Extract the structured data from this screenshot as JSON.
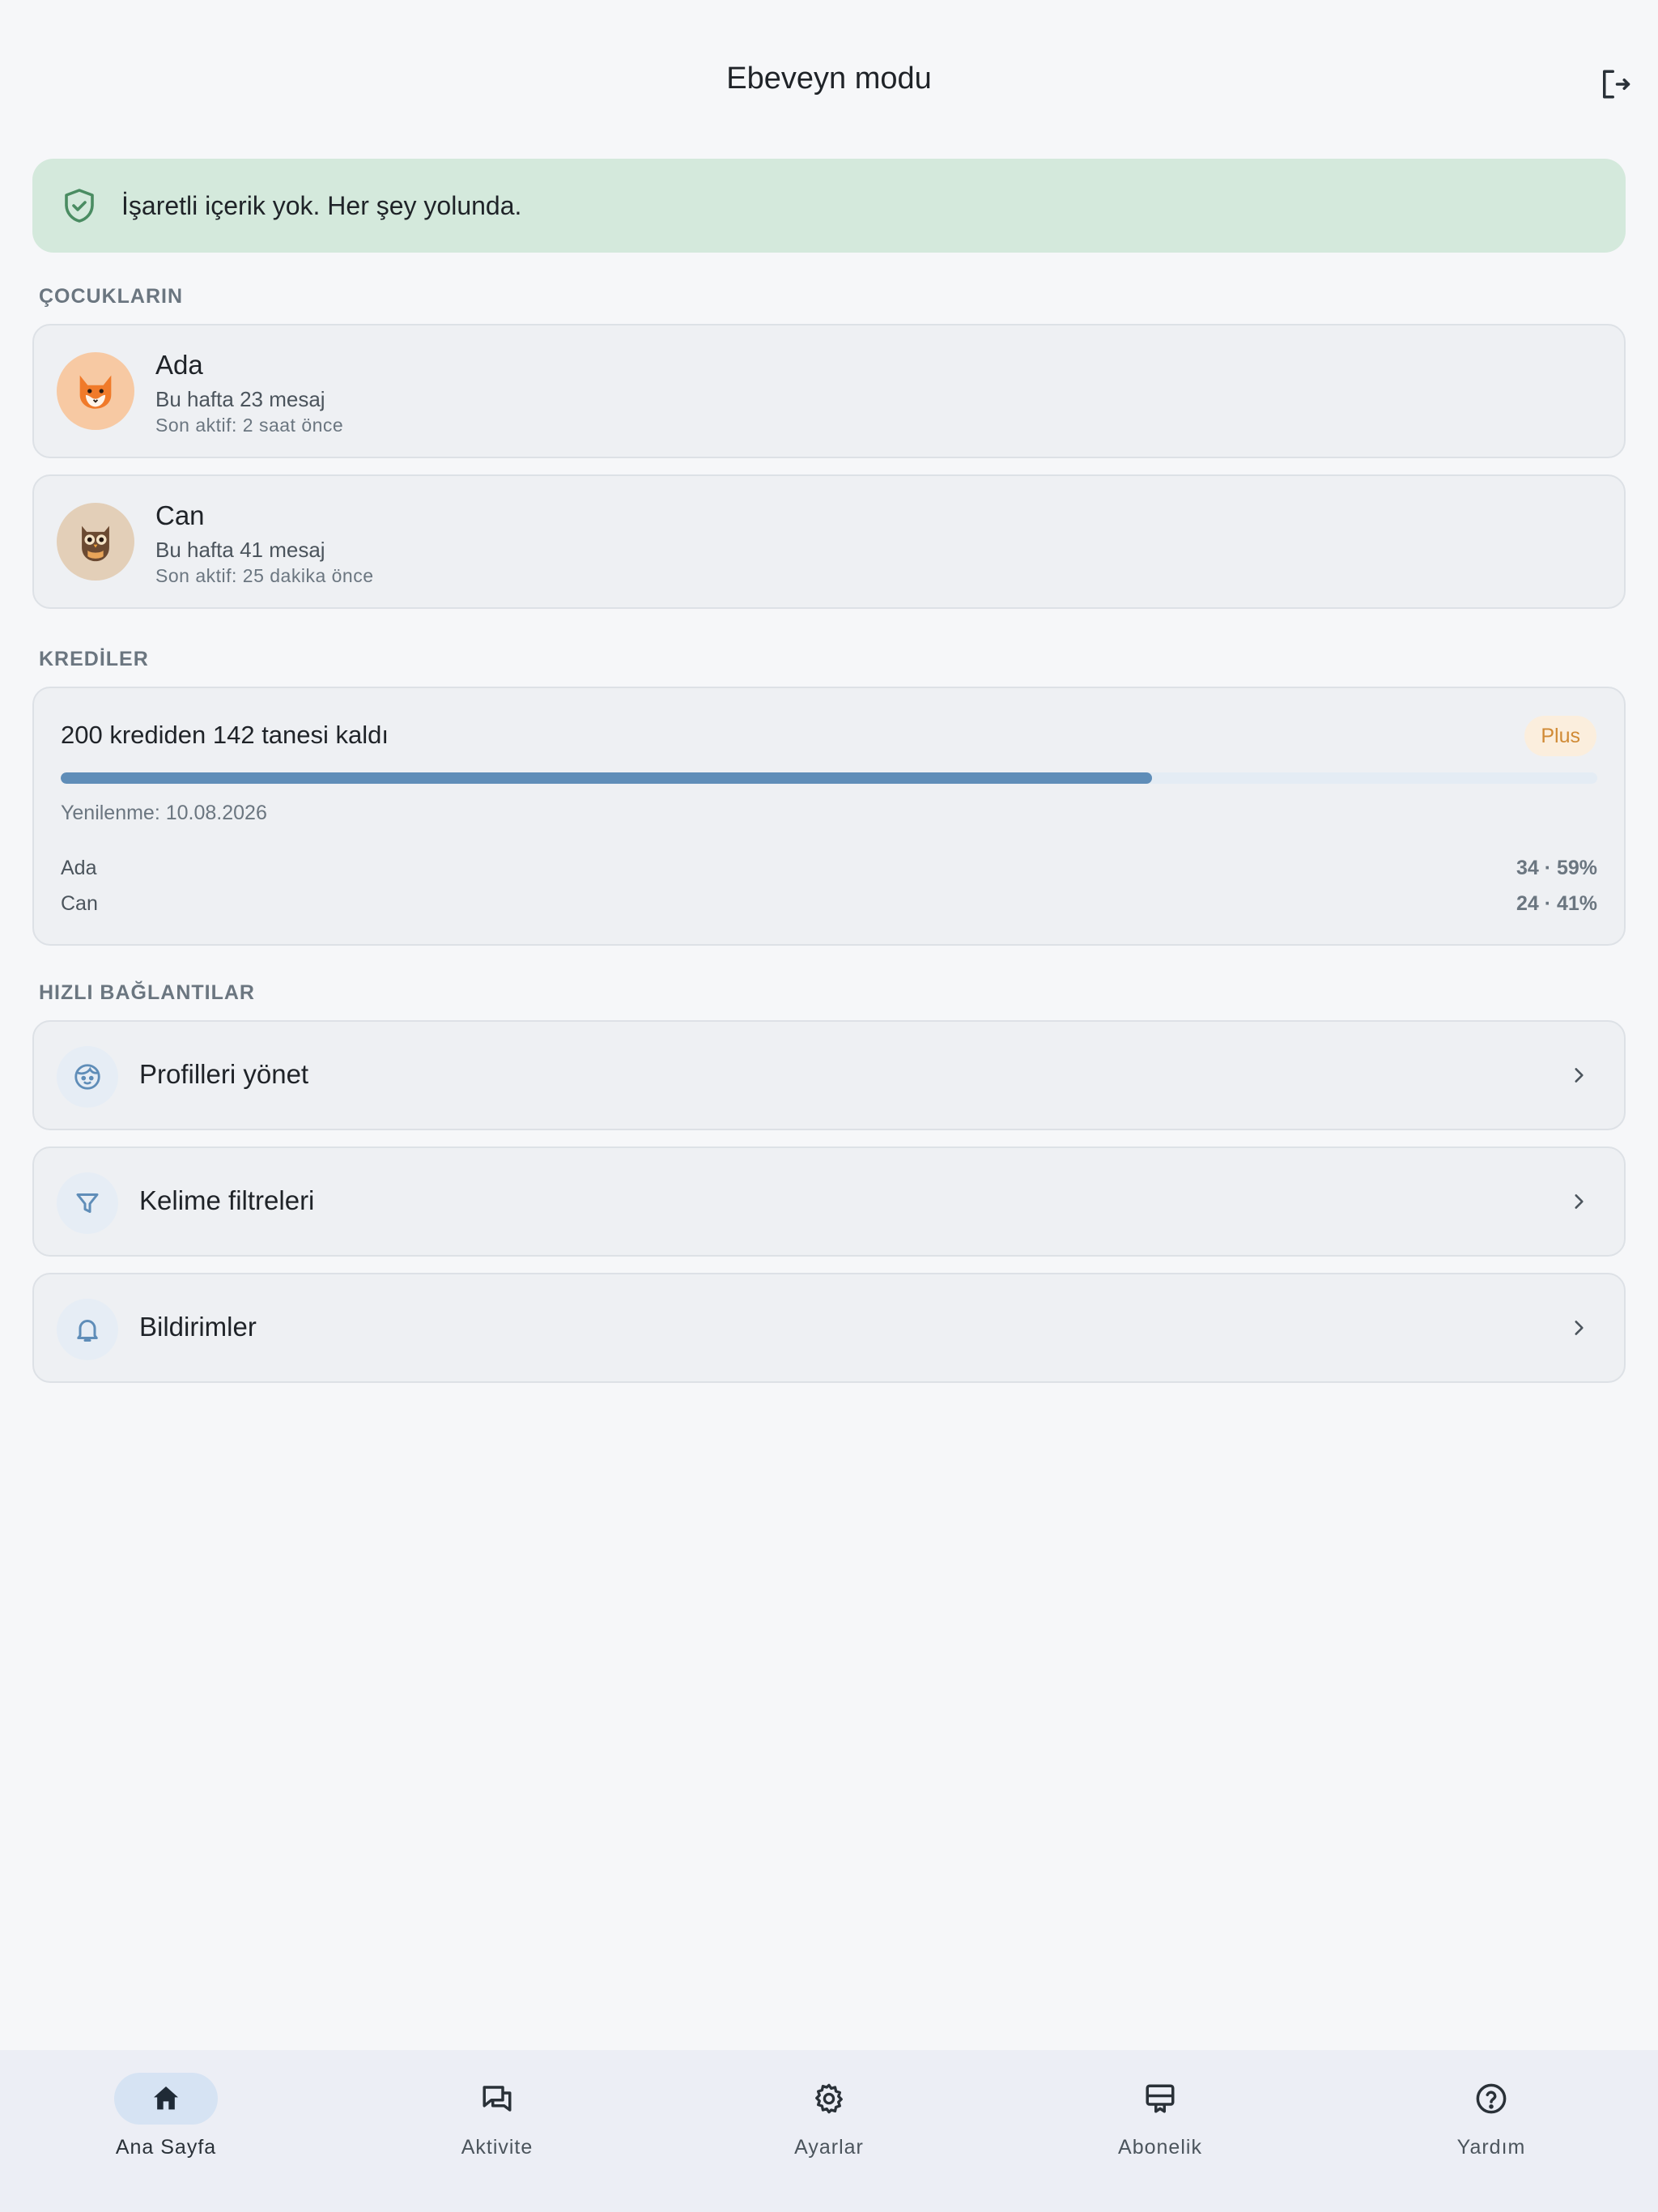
{
  "header": {
    "title": "Ebeveyn modu",
    "logout_icon": "logout-icon"
  },
  "banner": {
    "text": "İşaretli içerik yok. Her şey yolunda.",
    "icon": "shield-check-icon",
    "color": "#d4e9dc"
  },
  "children_section": {
    "label": "ÇOCUKLARIN",
    "items": [
      {
        "name": "Ada",
        "week": "Bu hafta 23 mesaj",
        "active": "Son aktif: 2 saat önce",
        "avatar": "fox-avatar",
        "avatar_bg": "#f7c9a3"
      },
      {
        "name": "Can",
        "week": "Bu hafta 41 mesaj",
        "active": "Son aktif: 25 dakika önce",
        "avatar": "owl-avatar",
        "avatar_bg": "#e3cfb8"
      }
    ]
  },
  "credits_section": {
    "label": "KREDİLER",
    "title": "200 krediden 142 tanesi kaldı",
    "plan": "Plus",
    "remaining": 142,
    "total": 200,
    "progress_fraction": 0.71,
    "renewal": "Yenilenme: 10.08.2026",
    "usage": [
      {
        "name": "Ada",
        "value": "34 · 59%"
      },
      {
        "name": "Can",
        "value": "24 · 41%"
      }
    ],
    "accent": "#5f8db8"
  },
  "links_section": {
    "label": "HIZLI BAĞLANTILAR",
    "items": [
      {
        "label": "Profilleri yönet",
        "icon": "child-face-icon"
      },
      {
        "label": "Kelime filtreleri",
        "icon": "filter-icon"
      },
      {
        "label": "Bildirimler",
        "icon": "bell-icon"
      }
    ]
  },
  "bottom_nav": {
    "items": [
      {
        "label": "Ana Sayfa",
        "icon": "home-icon",
        "active": true
      },
      {
        "label": "Aktivite",
        "icon": "chat-icon",
        "active": false
      },
      {
        "label": "Ayarlar",
        "icon": "gear-icon",
        "active": false
      },
      {
        "label": "Abonelik",
        "icon": "subscription-icon",
        "active": false
      },
      {
        "label": "Yardım",
        "icon": "help-icon",
        "active": false
      }
    ]
  }
}
